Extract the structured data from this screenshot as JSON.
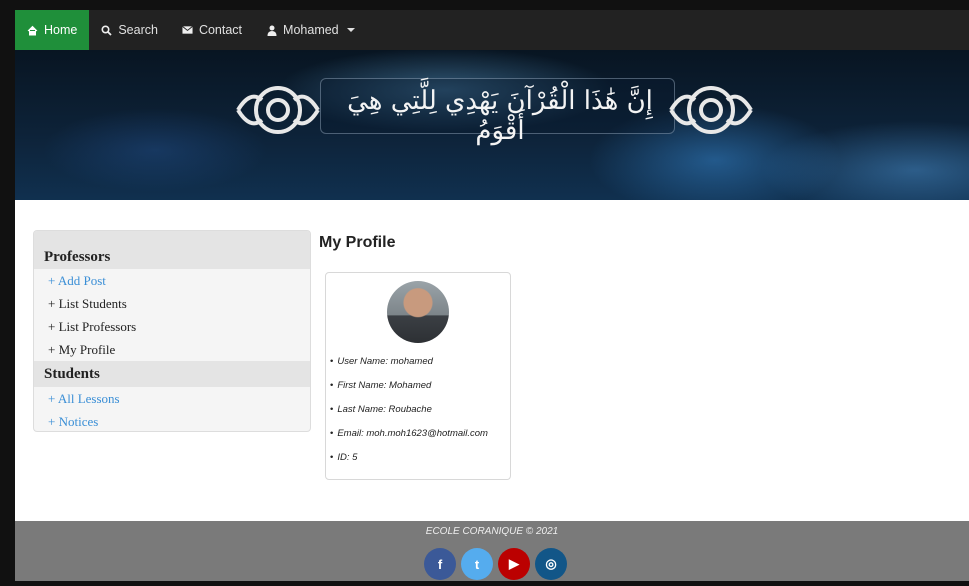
{
  "nav": {
    "items": [
      {
        "label": "Home",
        "icon": "home-icon",
        "active": true
      },
      {
        "label": "Search",
        "icon": "search-icon",
        "active": false
      },
      {
        "label": "Contact",
        "icon": "envelope-icon",
        "active": false
      },
      {
        "label": "Mohamed",
        "icon": "user-icon",
        "active": false
      }
    ],
    "active_color": "#1f8f3a",
    "bg_color": "#222222"
  },
  "banner": {
    "text": "إِنَّ هَٰذَا الْقُرْآنَ يَهْدِي لِلَّتِي هِيَ أَقْوَمُ"
  },
  "sidebar": {
    "professors_heading": "Professors",
    "professors_items": [
      "+ Add Post",
      "+ List Students",
      "+ List Professors",
      "+ My Profile"
    ],
    "students_heading": "Students",
    "students_items": [
      "+ All Lessons",
      "+ Notices"
    ]
  },
  "main": {
    "title": "My Profile",
    "profile": [
      "User Name: mohamed",
      "First Name: Mohamed",
      "Last Name: Roubache",
      "Email: moh.moh1623@hotmail.com",
      "ID: 5"
    ]
  },
  "footer": {
    "text": "ECOLE CORANIQUE © 2021",
    "socials": [
      {
        "icon": "facebook-icon",
        "glyph": "f",
        "color": "#3b5998"
      },
      {
        "icon": "twitter-icon",
        "glyph": "t",
        "color": "#55acee"
      },
      {
        "icon": "youtube-icon",
        "glyph": "▶",
        "color": "#bb0000"
      },
      {
        "icon": "instagram-icon",
        "glyph": "◎",
        "color": "#125688"
      }
    ]
  }
}
